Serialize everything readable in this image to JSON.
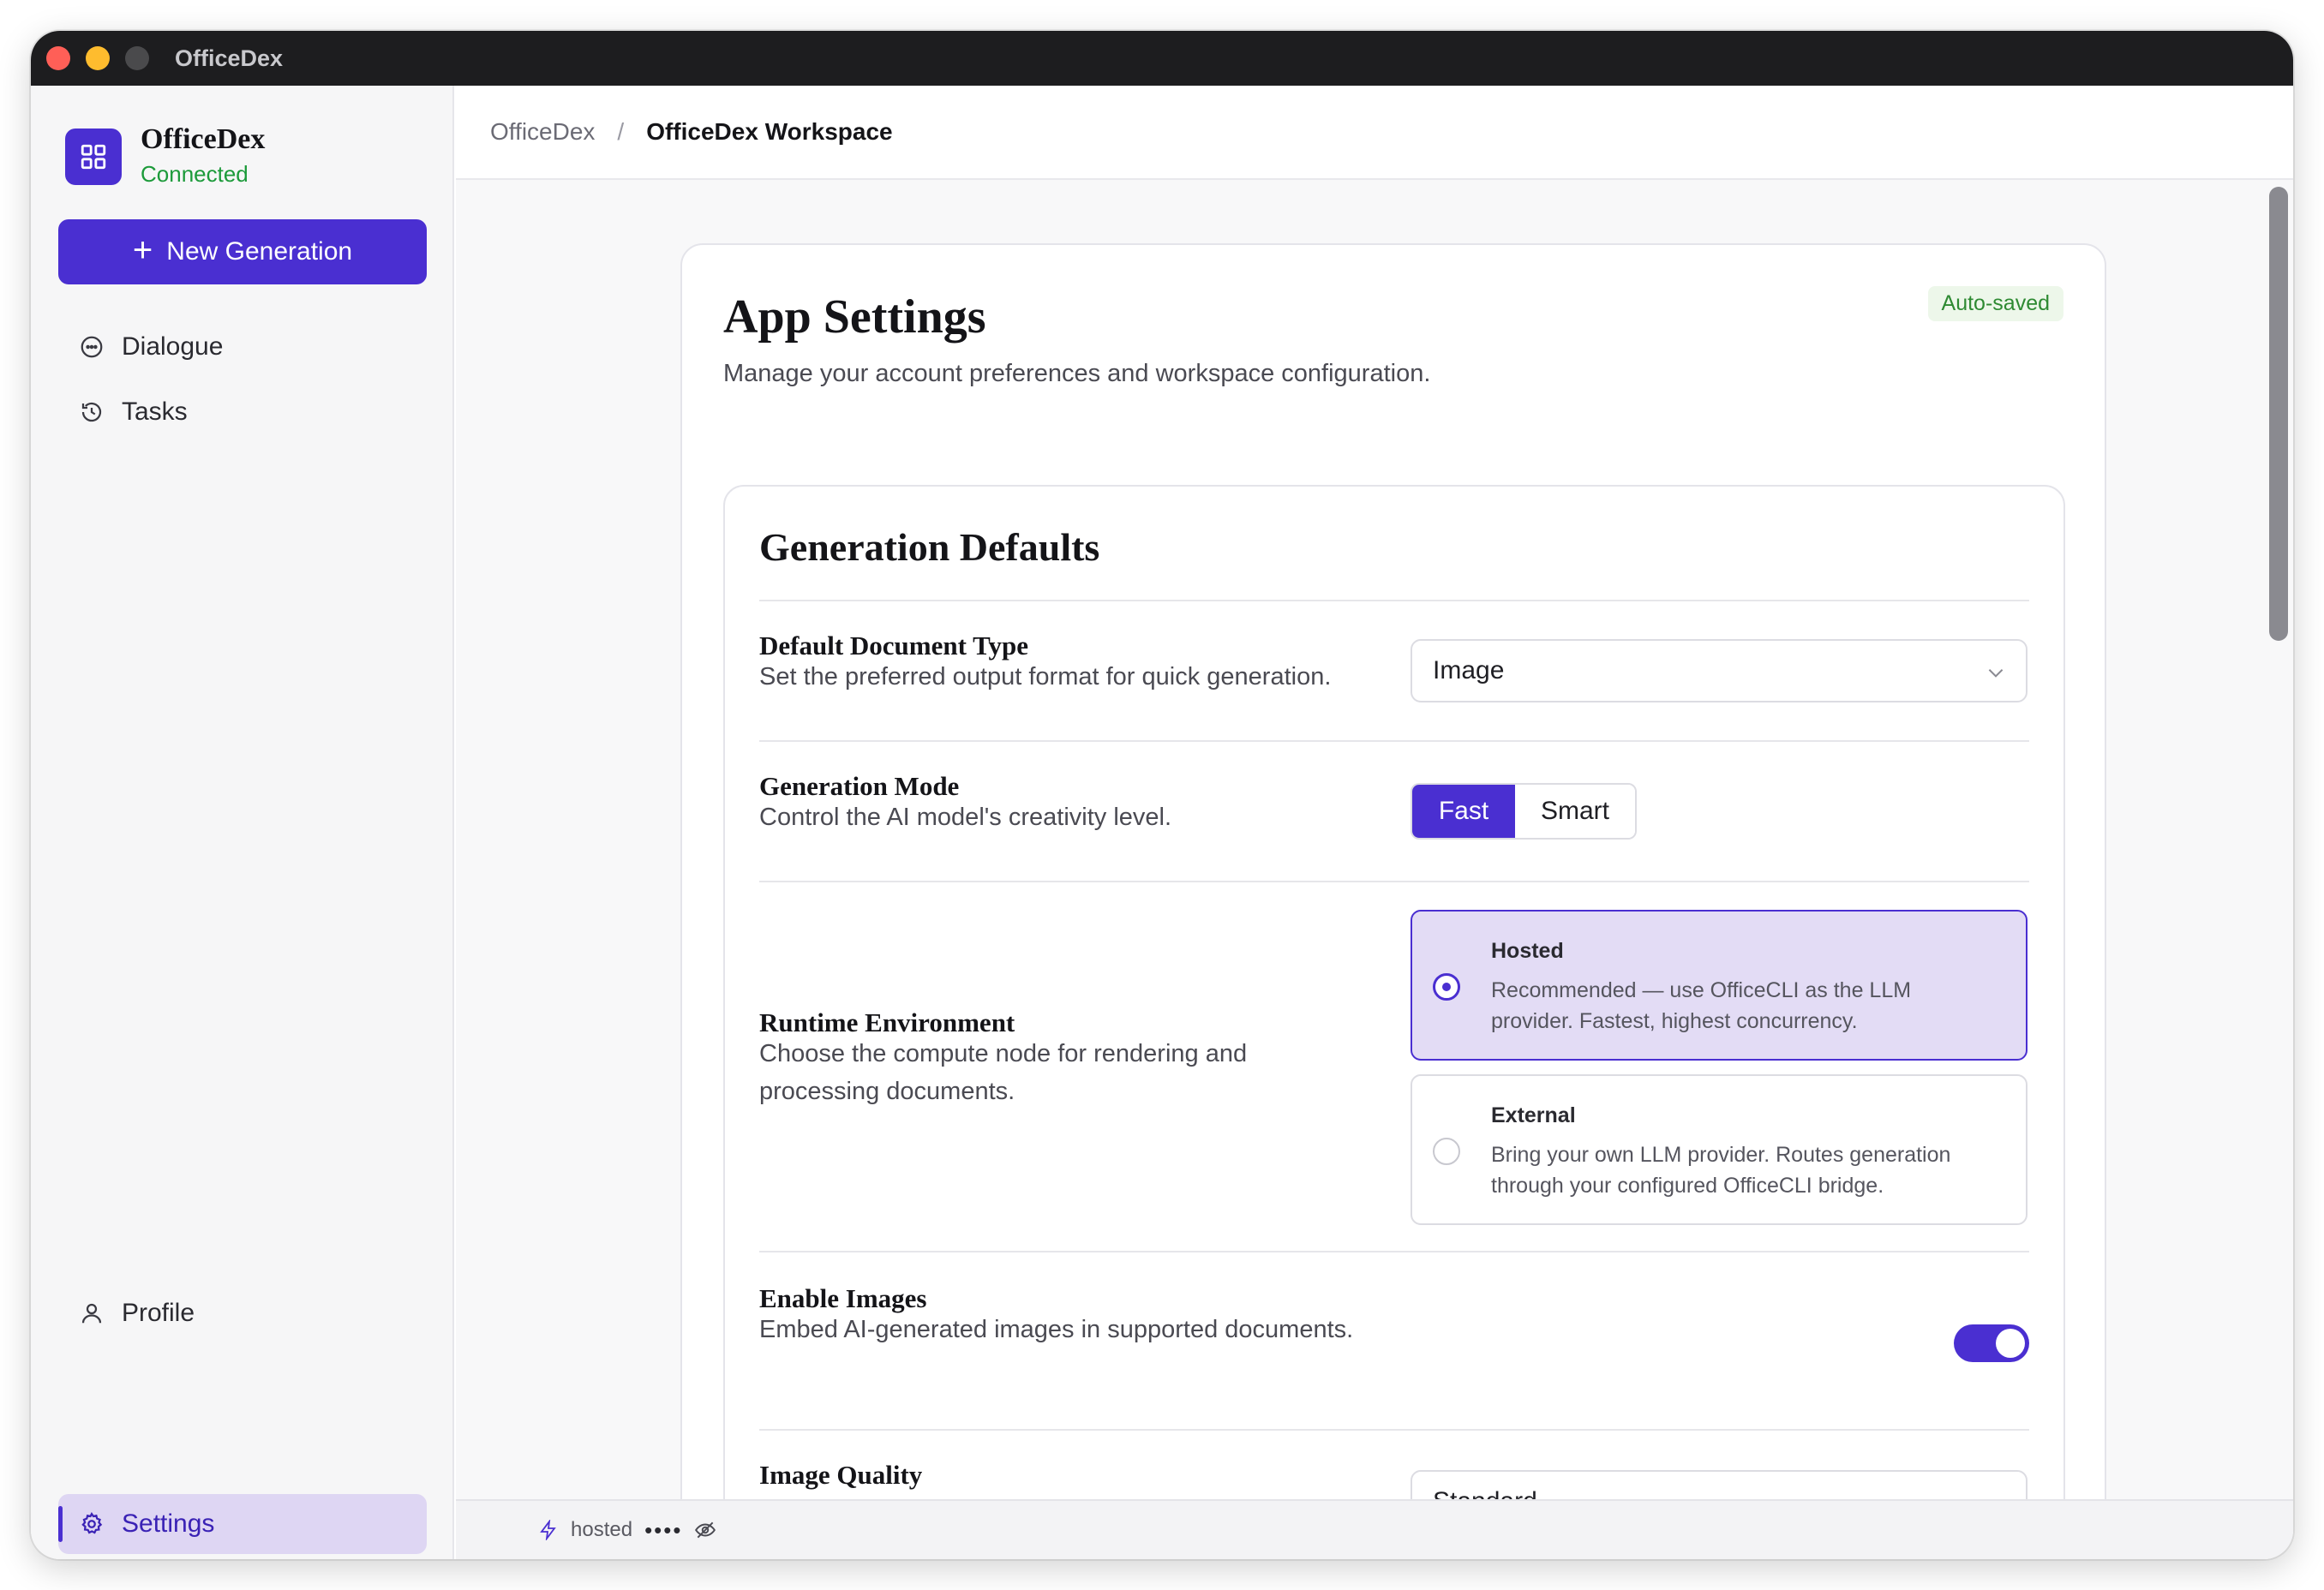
{
  "window": {
    "title": "OfficeDex"
  },
  "sidebar": {
    "brand_name": "OfficeDex",
    "brand_status": "Connected",
    "new_button": "New Generation",
    "nav": [
      {
        "label": "Dialogue",
        "icon": "chat-bubble-icon"
      },
      {
        "label": "Tasks",
        "icon": "history-icon"
      }
    ],
    "bottom_nav": [
      {
        "label": "Profile",
        "icon": "user-icon"
      },
      {
        "label": "Settings",
        "icon": "gear-icon",
        "active": true
      }
    ]
  },
  "breadcrumb": {
    "root": "OfficeDex",
    "separator": "/",
    "current": "OfficeDex Workspace"
  },
  "settings": {
    "title": "App Settings",
    "subtitle": "Manage your account preferences and workspace configuration.",
    "autosave_badge": "Auto-saved",
    "section_title": "Generation Defaults",
    "doc_type": {
      "label": "Default Document Type",
      "description": "Set the preferred output format for quick generation.",
      "value": "Image"
    },
    "mode": {
      "label": "Generation Mode",
      "description": "Control the AI model's creativity level.",
      "options": [
        "Fast",
        "Smart"
      ],
      "selected": "Fast"
    },
    "runtime": {
      "label": "Runtime Environment",
      "description": "Choose the compute node for rendering and processing documents.",
      "options": [
        {
          "title": "Hosted",
          "description": "Recommended — use OfficeCLI as the LLM provider. Fastest, highest concurrency.",
          "selected": true
        },
        {
          "title": "External",
          "description": "Bring your own LLM provider. Routes generation through your configured OfficeCLI bridge.",
          "selected": false
        }
      ]
    },
    "images": {
      "label": "Enable Images",
      "description": "Embed AI-generated images in supported documents.",
      "enabled": true
    },
    "quality": {
      "label": "Image Quality",
      "value": "Standard"
    }
  },
  "status": {
    "mode": "hosted",
    "key_mask": "••••"
  },
  "colors": {
    "accent": "#4a2fd1",
    "connected": "#1c9a3a",
    "titlebar": "#1d1d1f"
  }
}
